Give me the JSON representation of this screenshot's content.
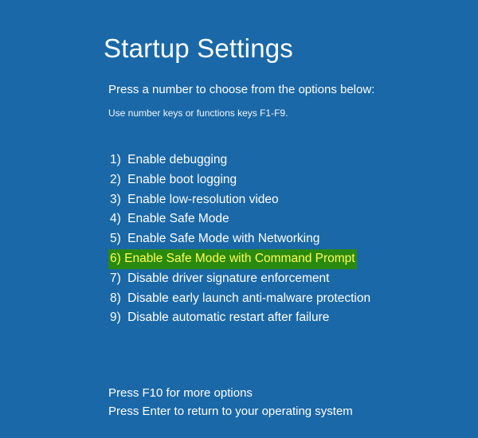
{
  "title": "Startup Settings",
  "instruction": "Press a number to choose from the options below:",
  "hint": "Use number keys or functions keys F1-F9.",
  "options": [
    {
      "num": "1)",
      "label": "Enable debugging",
      "highlight": false
    },
    {
      "num": "2)",
      "label": "Enable boot logging",
      "highlight": false
    },
    {
      "num": "3)",
      "label": "Enable low-resolution video",
      "highlight": false
    },
    {
      "num": "4)",
      "label": "Enable Safe Mode",
      "highlight": false
    },
    {
      "num": "5)",
      "label": "Enable Safe Mode with Networking",
      "highlight": false
    },
    {
      "num": "6)",
      "label": "Enable Safe Mode with Command Prompt",
      "highlight": true
    },
    {
      "num": "7)",
      "label": "Disable driver signature enforcement",
      "highlight": false
    },
    {
      "num": "8)",
      "label": "Disable early launch anti-malware protection",
      "highlight": false
    },
    {
      "num": "9)",
      "label": "Disable automatic restart after failure",
      "highlight": false
    }
  ],
  "footer": {
    "more": "Press F10 for more options",
    "back": "Press Enter to return to your operating system"
  },
  "colors": {
    "bg": "#1a68a7",
    "highlight_bg": "#2a8a0f",
    "highlight_fg": "#fffd54"
  }
}
